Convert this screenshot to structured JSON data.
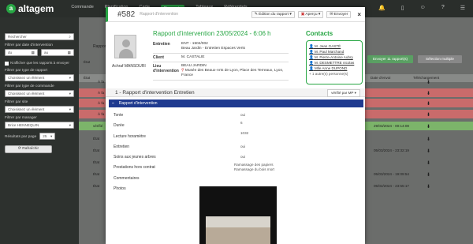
{
  "app": {
    "name": "altagem"
  },
  "topnav": [
    "Commande",
    "Planification",
    "Carte",
    "Rapports",
    "Tableaux",
    "Référentiels"
  ],
  "sidebar": {
    "search_placeholder": "Rechercher",
    "date_label": "Filtrer par date d'intervention",
    "date_from": "du",
    "date_to": "au",
    "unsent_label": "N'afficher que les rapports à envoyer",
    "report_type_label": "Filtrer par type de rapport",
    "report_type_value": "Choisissez un élément",
    "order_type_label": "Filtrer par type de commande",
    "order_type_value": "Choisissez un élément",
    "site_label": "Filtrer par site",
    "site_value": "Choisissez un élément",
    "manager_label": "Filtrer par manager",
    "manager_value": "Brice HENNEQUIN",
    "results_label": "Résultats par page",
    "results_value": "25",
    "refresh_label": "Rafraîchir"
  },
  "background": {
    "rapports_label": "Rapports",
    "send_button": "Envoyer 11 rapport(s)",
    "select_button": "Sélection multiple",
    "col_state": "État",
    "col_date_sent": "Date d'envoi",
    "col_download": "Téléchargement",
    "rows": [
      {
        "state": "État",
        "date": ""
      },
      {
        "state": "À fa",
        "date": ""
      },
      {
        "state": "À fa",
        "date": ""
      },
      {
        "state": "À fa",
        "date": ""
      },
      {
        "state": "À fa",
        "date": ""
      },
      {
        "state": "vérifié",
        "date": "29/03/2024 - 00:14:08"
      },
      {
        "state": "État",
        "date": ""
      },
      {
        "state": "État",
        "date": "05/03/2024 - 23:32:19"
      },
      {
        "state": "État",
        "date": ""
      },
      {
        "state": "État",
        "date": "05/03/2024 - 19:09:54"
      },
      {
        "state": "État",
        "date": "05/02/2024 - 23:55:17"
      }
    ]
  },
  "modal": {
    "number": "#582",
    "subtitle": "Rapport d'intervention",
    "edit_button": "Édition du rapport",
    "preview_button": "Aperçu",
    "send_button": "Envoyer",
    "close": "×",
    "technician": "Achraf MANSOURI",
    "report_title": "Rapport d'intervention 23/05/2024 - 6:06 h",
    "entretien_label": "Entretien",
    "entretien_value": "ENT - 1504/002",
    "entretien_sub": "Beau Jardin - Entretien Espaces Verts",
    "client_label": "Client",
    "client_value": "M. CASTALIE",
    "lieu_label": "Lieu d'intervention",
    "lieu_name": "BEAU JARDIN",
    "lieu_address": "Musée des Beaux-Arts de Lyon, Place des Terreaux, Lyon, France",
    "contacts_title": "Contacts",
    "contacts": [
      "M. Jean GASTÉ",
      "M. Paul Marchand",
      "M. Pierre-Antoine Aubry",
      "M. DESMETTRE nicolas",
      "Mlle Anne DUPOND"
    ],
    "contacts_more": "+ 1 autre(s) personne(s)",
    "section_title": "1 - Rapport d'intervention Entretien",
    "verified": "vérifié par MP",
    "bluebar_collapse": "–",
    "bluebar_title": "Rapport d'intervention",
    "fields": [
      {
        "label": "Tonte",
        "value": "oui"
      },
      {
        "label": "Durée",
        "value": "6"
      },
      {
        "label": "Lecture horamètre",
        "value": "1032"
      },
      {
        "label": "Entretien",
        "value": "oui"
      },
      {
        "label": "Soins aux jeunes arbres",
        "value": "oui"
      },
      {
        "label": "Prestations hors contrat",
        "value": "Ramassage des papiers"
      },
      {
        "label": "Commentaires",
        "value": ""
      },
      {
        "label": "Photos",
        "value": ""
      }
    ],
    "prestations_extra": "Ramassage du bois mort"
  },
  "colors": {
    "accent": "#27a644",
    "bluebar": "#1f3a8f",
    "row_red": "#c96b6b",
    "row_green": "#7cb46a"
  }
}
